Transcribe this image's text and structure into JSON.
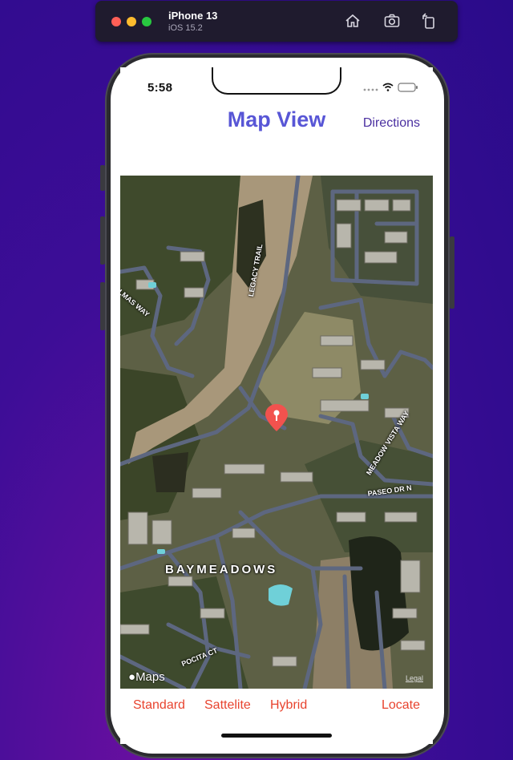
{
  "simulator": {
    "device_name": "iPhone 13",
    "os_version": "iOS 15.2",
    "icons": [
      "home-icon",
      "screenshot-icon",
      "rotate-icon"
    ]
  },
  "status_bar": {
    "time": "5:58"
  },
  "nav": {
    "title": "Map View",
    "right_button": "Directions"
  },
  "map": {
    "type": "satellite",
    "labels": {
      "street_1": "LEGACY TRAIL",
      "street_2": "LMAS WAY",
      "street_3": "MEADOW VISTA WAY",
      "street_4": "PASEO DR N",
      "street_5": "POCITA CT",
      "area": "BAYMEADOWS"
    },
    "attribution": "Maps",
    "legal": "Legal",
    "pin_color": "#f2524e"
  },
  "toolbar": {
    "standard": "Standard",
    "satellite": "Sattelite",
    "hybrid": "Hybrid",
    "locate": "Locate"
  },
  "colors": {
    "accent": "#5856d6",
    "toolbar_text": "#e8432e"
  }
}
